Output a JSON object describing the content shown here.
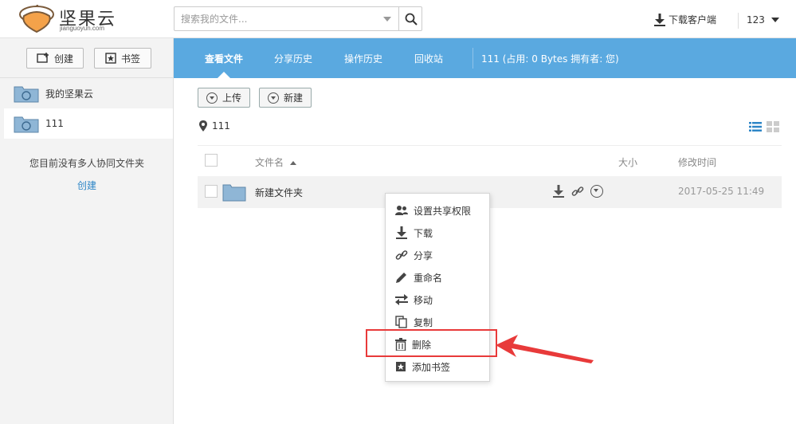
{
  "app": {
    "logo_text": "坚果云",
    "logo_sub": "jianguoyun.com"
  },
  "search": {
    "placeholder": "搜索我的文件..."
  },
  "topbar": {
    "download_client": "下载客户端",
    "username": "123"
  },
  "sidebar": {
    "create_label": "创建",
    "bookmark_label": "书签",
    "items": [
      {
        "label": "我的坚果云"
      },
      {
        "label": "111"
      }
    ],
    "empty_text": "您目前没有多人协同文件夹",
    "create_link": "创建"
  },
  "nav": {
    "tabs": [
      {
        "label": "查看文件"
      },
      {
        "label": "分享历史"
      },
      {
        "label": "操作历史"
      },
      {
        "label": "回收站"
      }
    ],
    "info": "111 (占用: 0 Bytes 拥有者: 您)"
  },
  "toolbar": {
    "upload_label": "上传",
    "new_label": "新建"
  },
  "breadcrumb": {
    "path": "111"
  },
  "table": {
    "headers": {
      "name": "文件名",
      "size": "大小",
      "modified": "修改时间"
    },
    "rows": [
      {
        "name": "新建文件夹",
        "size": "",
        "modified": "2017-05-25 11:49"
      }
    ]
  },
  "context_menu": {
    "items": [
      {
        "label": "设置共享权限",
        "icon": "users-icon"
      },
      {
        "label": "下载",
        "icon": "download-icon"
      },
      {
        "label": "分享",
        "icon": "link-icon"
      },
      {
        "label": "重命名",
        "icon": "pencil-icon"
      },
      {
        "label": "移动",
        "icon": "move-arrows-icon"
      },
      {
        "label": "复制",
        "icon": "copy-icon"
      },
      {
        "label": "删除",
        "icon": "trash-icon"
      },
      {
        "label": "添加书签",
        "icon": "bookmark-icon"
      }
    ]
  },
  "colors": {
    "nav_bg": "#5aa9e0",
    "link": "#2e86c7",
    "highlight": "#e83a3a"
  }
}
